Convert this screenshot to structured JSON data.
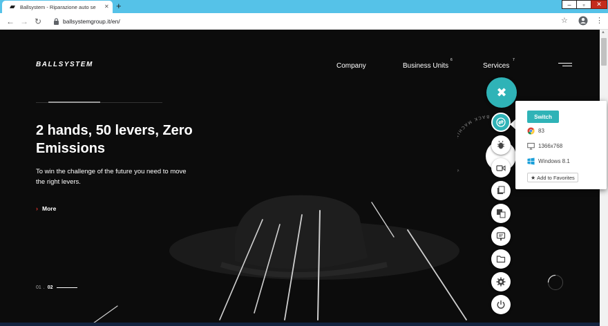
{
  "browser": {
    "tab_title": "Ballsystem - Riparazione auto se",
    "tab_close": "✕",
    "new_tab": "+",
    "url": "ballsystemgroup.it/en/",
    "window": {
      "minimize": "–",
      "maximize": "▫",
      "close": "✕"
    },
    "icons": {
      "back": "arrow-left-icon",
      "forward": "arrow-right-icon",
      "reload": "reload-icon",
      "lock": "lock-icon",
      "star": "star-icon",
      "profile": "profile-icon",
      "menu": "more-vert-icon"
    },
    "glyphs": {
      "back": "←",
      "forward": "→",
      "reload": "↻",
      "star": "☆",
      "menu": "⋮"
    }
  },
  "site": {
    "logo": "BALLSYSTEM",
    "nav": [
      {
        "label": "Company",
        "sup": ""
      },
      {
        "label": "Business Units",
        "sup": "6"
      },
      {
        "label": "Services",
        "sup": "7"
      }
    ],
    "hero": {
      "title": "2 hands, 50 levers, Zero Emissions",
      "subtitle": "To win the challenge of the future you need to move the right levers.",
      "more_arrow": "›",
      "more_label": "More"
    },
    "pager": {
      "first": "01",
      "separator": ".",
      "current": "02"
    },
    "rotating_text": "BACK MACHINE TIMELINE"
  },
  "extension": {
    "close_glyph": "✖",
    "buttons": [
      "switch-browser-icon",
      "bug-icon",
      "video-icon",
      "screenshot-icon",
      "responsive-icon",
      "comment-icon",
      "folder-icon",
      "settings-icon",
      "power-icon"
    ],
    "popover": {
      "switch_label": "Switch",
      "browser_version": "83",
      "resolution": "1366x768",
      "os": "Windows 8.1",
      "favorites_label": "Add to Favorites",
      "favorites_star": "★"
    },
    "colors": {
      "accent": "#2fb3b7"
    }
  },
  "colors": {
    "tabbar": "#55c2e8",
    "page_bg": "#0c0c0c",
    "more_arrow": "#e0322b"
  }
}
